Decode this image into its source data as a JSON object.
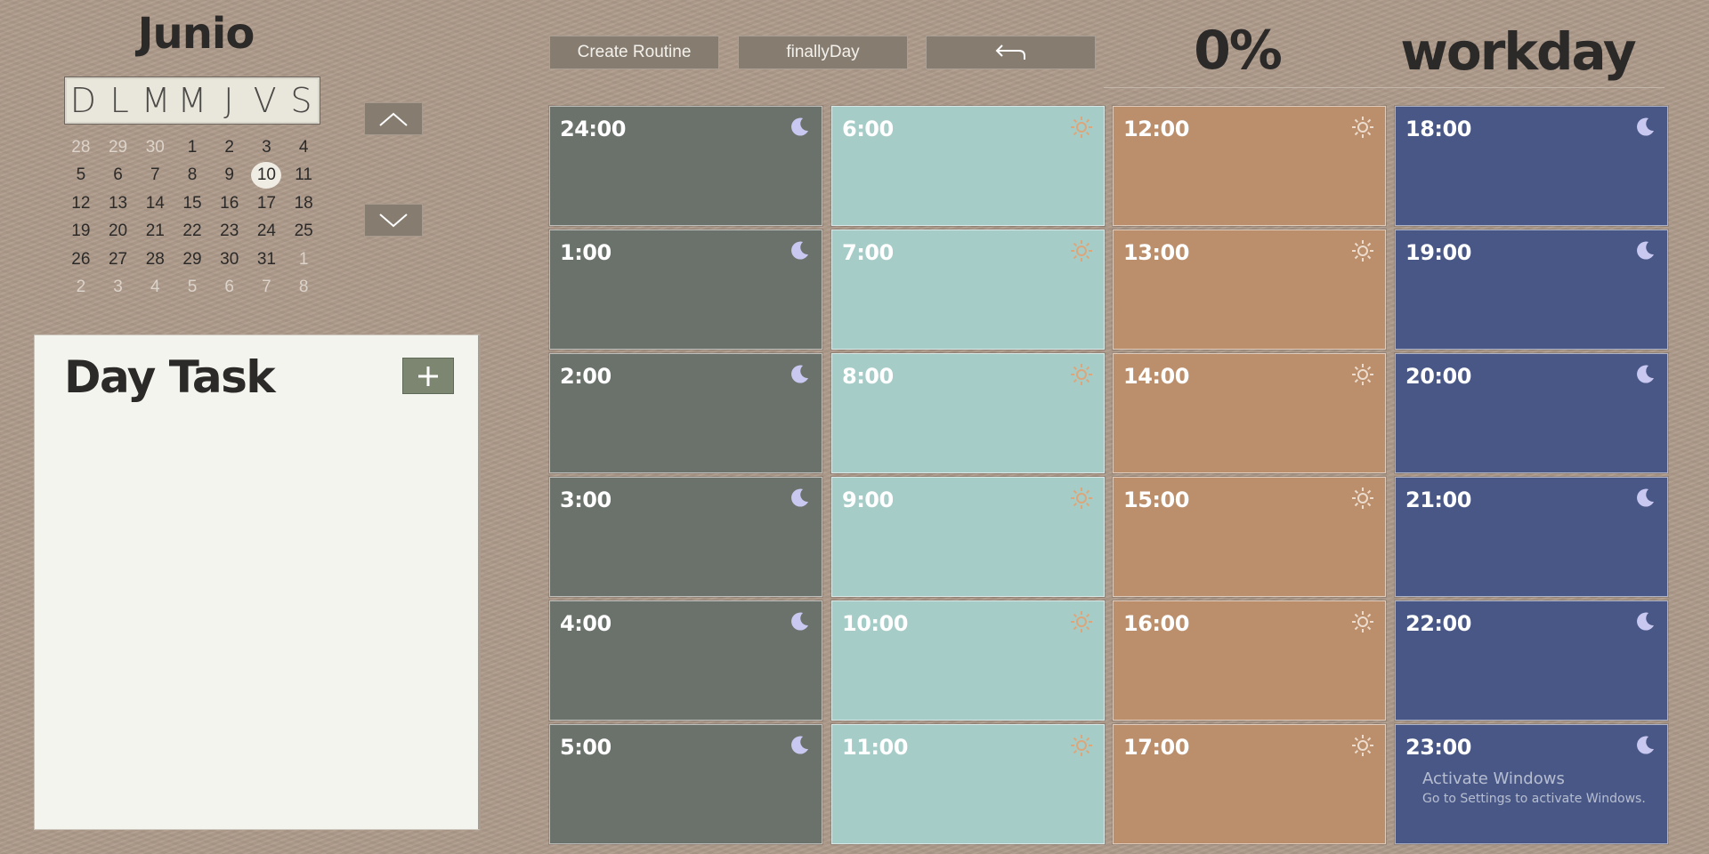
{
  "calendar": {
    "month": "Junio",
    "weekdays": [
      "D",
      "L",
      "M",
      "M",
      "J",
      "V",
      "S"
    ],
    "days": [
      {
        "n": "28",
        "muted": true
      },
      {
        "n": "29",
        "muted": true
      },
      {
        "n": "30",
        "muted": true
      },
      {
        "n": "1"
      },
      {
        "n": "2"
      },
      {
        "n": "3"
      },
      {
        "n": "4"
      },
      {
        "n": "5"
      },
      {
        "n": "6"
      },
      {
        "n": "7"
      },
      {
        "n": "8"
      },
      {
        "n": "9"
      },
      {
        "n": "10",
        "selected": true
      },
      {
        "n": "11"
      },
      {
        "n": "12"
      },
      {
        "n": "13"
      },
      {
        "n": "14"
      },
      {
        "n": "15"
      },
      {
        "n": "16"
      },
      {
        "n": "17"
      },
      {
        "n": "18"
      },
      {
        "n": "19"
      },
      {
        "n": "20"
      },
      {
        "n": "21"
      },
      {
        "n": "22"
      },
      {
        "n": "23"
      },
      {
        "n": "24"
      },
      {
        "n": "25"
      },
      {
        "n": "26"
      },
      {
        "n": "27"
      },
      {
        "n": "28"
      },
      {
        "n": "29"
      },
      {
        "n": "30"
      },
      {
        "n": "31"
      },
      {
        "n": "1",
        "muted": true
      },
      {
        "n": "2",
        "muted": true
      },
      {
        "n": "3",
        "muted": true
      },
      {
        "n": "4",
        "muted": true
      },
      {
        "n": "5",
        "muted": true
      },
      {
        "n": "6",
        "muted": true
      },
      {
        "n": "7",
        "muted": true
      },
      {
        "n": "8",
        "muted": true
      }
    ],
    "prev_icon": "chevron-up-icon",
    "next_icon": "chevron-down-icon"
  },
  "tasks": {
    "title": "Day Task",
    "add_icon": "plus-icon",
    "items": []
  },
  "toolbar": {
    "create_routine_label": "Create Routine",
    "finally_day_label": "finallyDay",
    "back_icon": "undo-arrow-icon"
  },
  "progress": {
    "percent_label": "0%",
    "day_type": "workday"
  },
  "colors": {
    "night_a": "#6a726b",
    "day_a": "#a6ccc7",
    "day_b": "#bc8f6c",
    "night_b": "#485786",
    "moon": "#c9c8f0",
    "sun_light": "#dda67a",
    "sun_dark": "#ecdccd"
  },
  "schedule": {
    "columns": [
      {
        "color_key": "night_a",
        "icon": "moon-icon",
        "hours": [
          "24:00",
          "1:00",
          "2:00",
          "3:00",
          "4:00",
          "5:00"
        ]
      },
      {
        "color_key": "day_a",
        "icon": "sun-icon",
        "hours": [
          "6:00",
          "7:00",
          "8:00",
          "9:00",
          "10:00",
          "11:00"
        ]
      },
      {
        "color_key": "day_b",
        "icon": "sun-icon",
        "hours": [
          "12:00",
          "13:00",
          "14:00",
          "15:00",
          "16:00",
          "17:00"
        ]
      },
      {
        "color_key": "night_b",
        "icon": "moon-icon",
        "hours": [
          "18:00",
          "19:00",
          "20:00",
          "21:00",
          "22:00",
          "23:00"
        ]
      }
    ]
  },
  "watermark": {
    "line1": "Activate Windows",
    "line2": "Go to Settings to activate Windows."
  }
}
